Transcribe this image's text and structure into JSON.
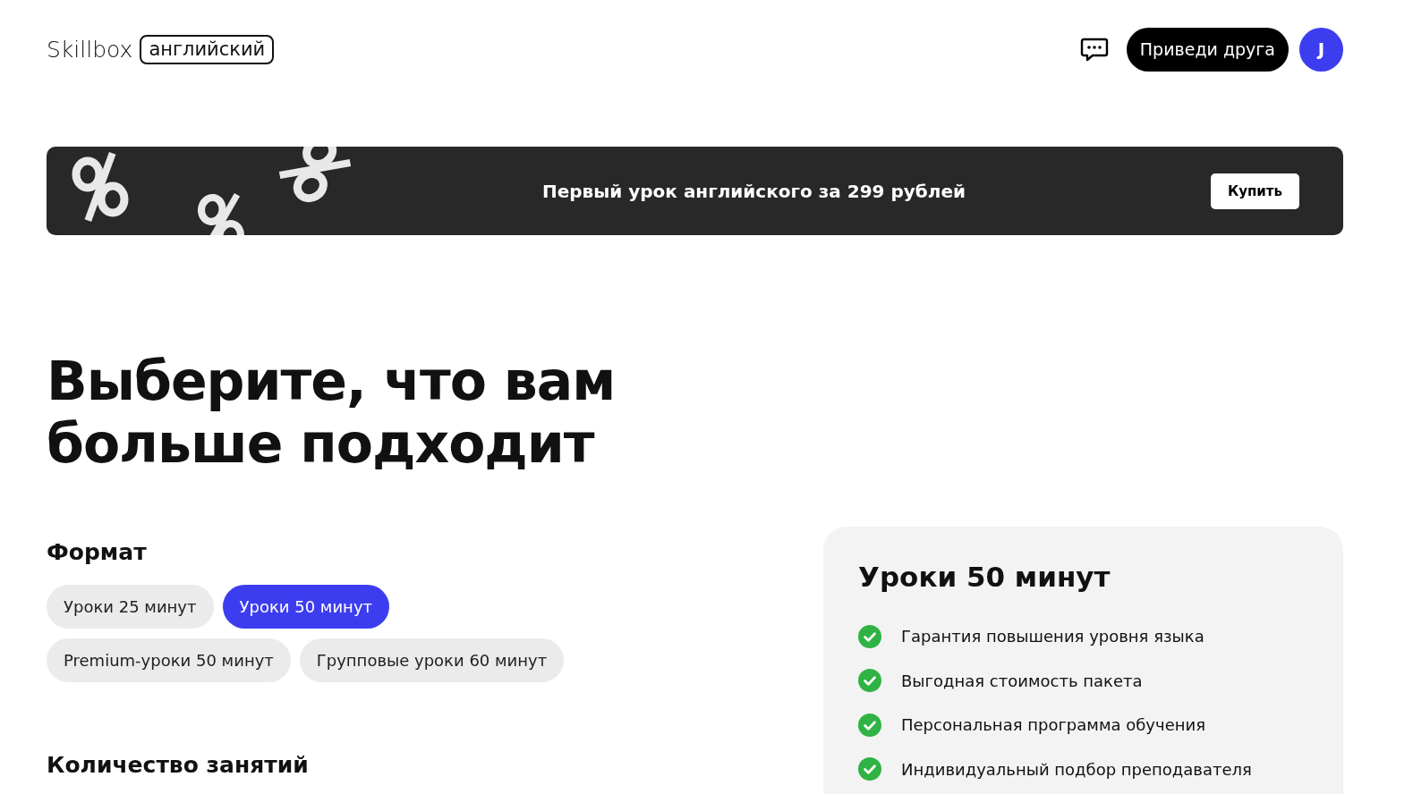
{
  "header": {
    "logo": "Skillbox",
    "logo_tag": "английский",
    "refer_button": "Приведи друга",
    "avatar": "J"
  },
  "banner": {
    "text": "Первый урок английского за 299 рублей",
    "button": "Купить"
  },
  "heading": "Выберите, что вам больше подходит",
  "format": {
    "title": "Формат",
    "options": [
      {
        "label": "Уроки 25 минут",
        "selected": false
      },
      {
        "label": "Уроки 50 минут",
        "selected": true
      },
      {
        "label": "Premium-уроки 50 минут",
        "selected": false
      },
      {
        "label": "Групповые уроки 60 минут",
        "selected": false
      }
    ]
  },
  "count": {
    "title": "Количество занятий"
  },
  "card": {
    "title": "Уроки 50 минут",
    "features": [
      "Гарантия повышения уровня языка",
      "Выгодная стоимость пакета",
      "Персональная программа обучения",
      "Индивидуальный подбор преподавателя"
    ]
  }
}
